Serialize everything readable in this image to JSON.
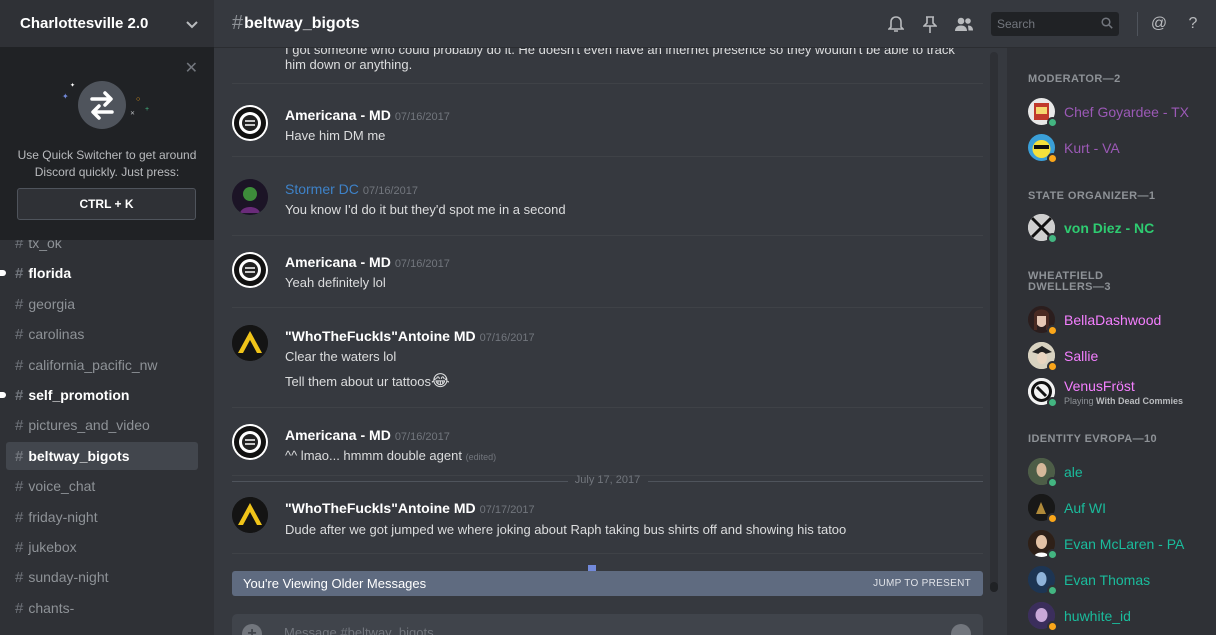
{
  "server": {
    "name": "Charlottesville 2.0"
  },
  "quick_switcher": {
    "tip_line1": "Use Quick Switcher to get around",
    "tip_line2": "Discord quickly. Just press:",
    "shortcut": "CTRL + K"
  },
  "channels": [
    {
      "name": "tx_ok",
      "state": "normal"
    },
    {
      "name": "florida",
      "state": "unread"
    },
    {
      "name": "georgia",
      "state": "normal"
    },
    {
      "name": "carolinas",
      "state": "normal"
    },
    {
      "name": "california_pacific_nw",
      "state": "normal"
    },
    {
      "name": "self_promotion",
      "state": "unread"
    },
    {
      "name": "pictures_and_video",
      "state": "normal"
    },
    {
      "name": "beltway_bigots",
      "state": "active"
    },
    {
      "name": "voice_chat",
      "state": "normal"
    },
    {
      "name": "friday-night",
      "state": "normal"
    },
    {
      "name": "jukebox",
      "state": "normal"
    },
    {
      "name": "sunday-night",
      "state": "normal"
    },
    {
      "name": "chants-",
      "state": "normal"
    }
  ],
  "header": {
    "hash": "#",
    "channel": "beltway_bigots",
    "search_placeholder": "Search",
    "mention_icon": "@",
    "help_icon": "?"
  },
  "messages": {
    "m0": {
      "line1": "I got someone who could probably do it. He doesn't even have an internet presence so they wouldn't be able to track",
      "line2": "him down or anything."
    },
    "m1": {
      "author": "Americana - MD",
      "time": "07/16/2017",
      "text": "Have him DM me"
    },
    "m2": {
      "author": "Stormer DC",
      "time": "07/16/2017",
      "text": "You know I'd do it but they'd spot me in a second"
    },
    "m3": {
      "author": "Americana - MD",
      "time": "07/16/2017",
      "text": "Yeah definitely lol"
    },
    "m4": {
      "author": "\"WhoTheFuckIs\"Antoine MD",
      "time": "07/16/2017",
      "text1": "Clear the waters lol",
      "text2": "Tell them about ur tattoos",
      "emoji": "😂"
    },
    "m5": {
      "author": "Americana - MD",
      "time": "07/16/2017",
      "text": "^^ lmao... hmmm double agent",
      "edited": "(edited)"
    },
    "date_divider": "July 17, 2017",
    "m6": {
      "author": "\"WhoTheFuckIs\"Antoine MD",
      "time": "07/17/2017",
      "text": "Dude after we got jumped we where joking about Raph taking bus shirts off and showing his tatoo"
    }
  },
  "older_bar": {
    "left": "You're Viewing Older Messages",
    "right": "JUMP TO PRESENT"
  },
  "composer": {
    "placeholder": "Message #beltway_bigots",
    "plus": "+"
  },
  "members": {
    "roles": {
      "moderator": "MODERATOR—2",
      "state_organizer": "STATE ORGANIZER—1",
      "wheatfield_1": "WHEATFIELD",
      "wheatfield_2": "DWELLERS—3",
      "identity": "IDENTITY EVROPA—10"
    },
    "list": {
      "chef": {
        "name": "Chef Goyardee - TX",
        "color": "#9b59b6",
        "status": "#43b581"
      },
      "kurt": {
        "name": "Kurt - VA",
        "color": "#9b59b6",
        "status": "#faa61a"
      },
      "diez": {
        "name": "von Diez - NC",
        "color": "#2ecc71",
        "status": "#43b581"
      },
      "bella": {
        "name": "BellaDashwood",
        "color": "#f47fff",
        "status": "#faa61a"
      },
      "sallie": {
        "name": "Sallie",
        "color": "#f47fff",
        "status": "#faa61a"
      },
      "venus": {
        "name": "VenusFröst",
        "color": "#f47fff",
        "status": "#43b581",
        "playing_prefix": "Playing",
        "game": "With Dead Commies"
      },
      "ale": {
        "name": "ale",
        "color": "#1abc9c",
        "status": "#43b581"
      },
      "auf": {
        "name": "Auf WI",
        "color": "#1abc9c",
        "status": "#faa61a"
      },
      "evanm": {
        "name": "Evan McLaren - PA",
        "color": "#1abc9c",
        "status": "#43b581"
      },
      "evant": {
        "name": "Evan Thomas",
        "color": "#1abc9c",
        "status": "#43b581"
      },
      "huwhite": {
        "name": "huwhite_id",
        "color": "#1abc9c",
        "status": "#faa61a"
      }
    }
  },
  "icons": [
    "chevron-down-icon",
    "close-icon",
    "quick-switcher-arrows-icon",
    "hash-icon",
    "bell-icon",
    "pin-icon",
    "members-icon",
    "search-icon",
    "mention-icon",
    "help-icon",
    "plus-icon",
    "emoji-icon"
  ]
}
